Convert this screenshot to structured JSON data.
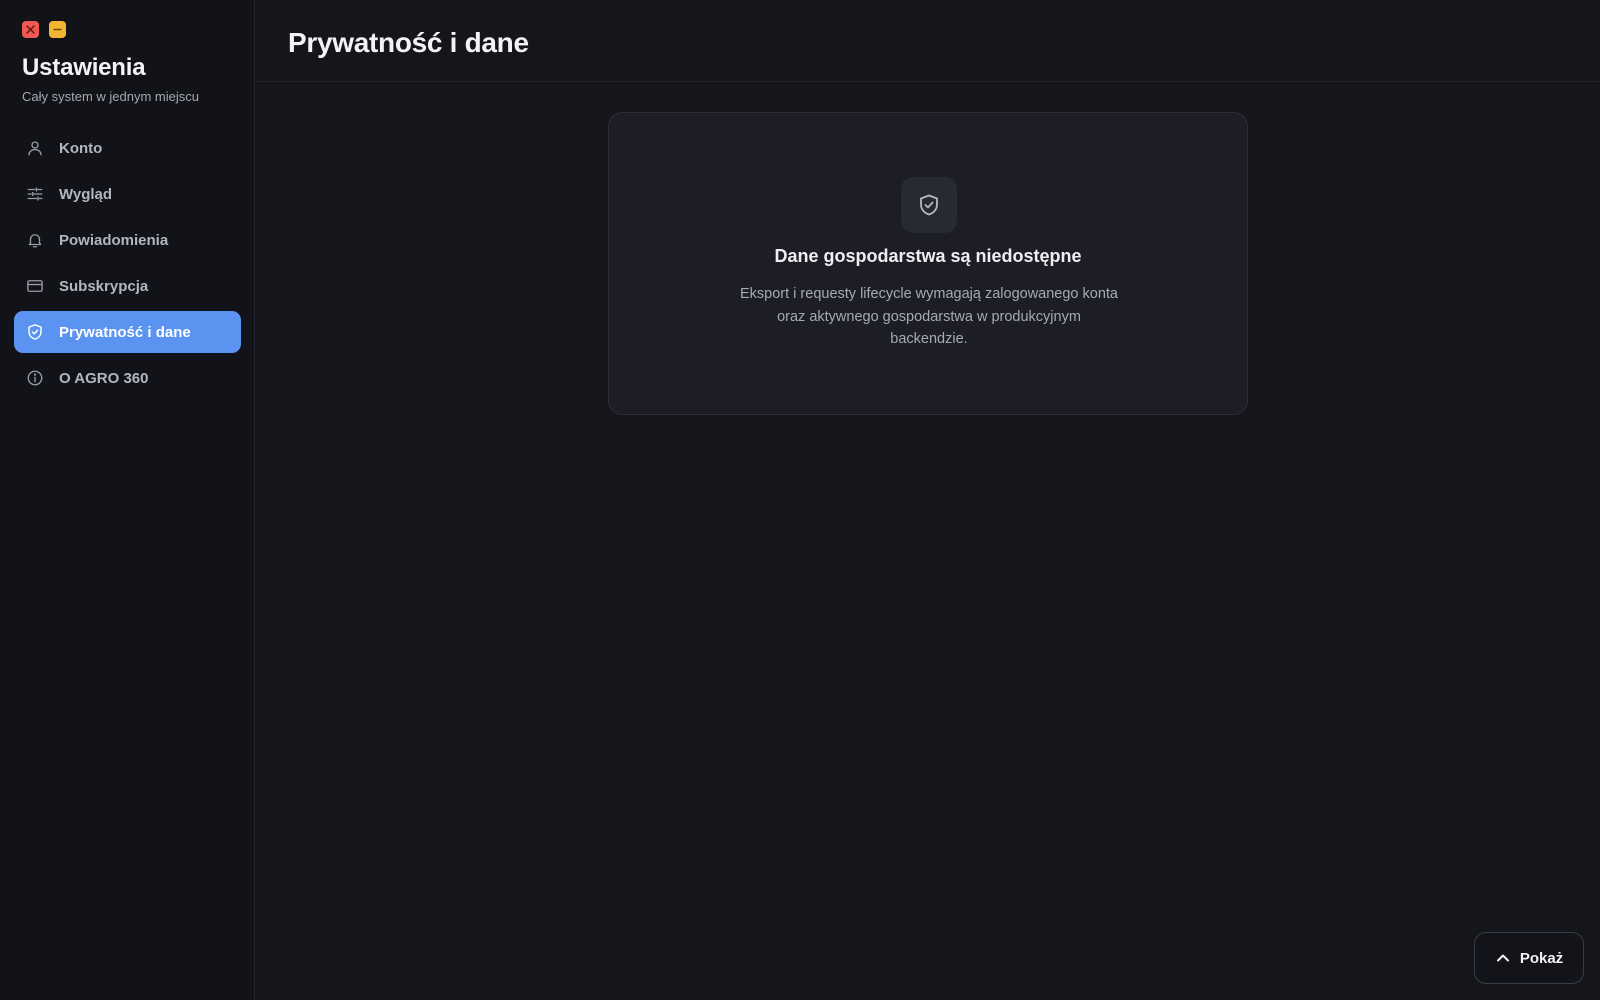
{
  "window": {
    "controls": [
      {
        "name": "close",
        "icon": "close-icon",
        "color": "#ee5a52"
      },
      {
        "name": "minimize",
        "icon": "minimize-icon",
        "color": "#f2b632"
      }
    ]
  },
  "sidebar": {
    "title": "Ustawienia",
    "subtitle": "Cały system w jednym miejscu",
    "items": [
      {
        "label": "Konto",
        "icon": "user-icon",
        "active": false
      },
      {
        "label": "Wygląd",
        "icon": "sliders-icon",
        "active": false
      },
      {
        "label": "Powiadomienia",
        "icon": "bell-icon",
        "active": false
      },
      {
        "label": "Subskrypcja",
        "icon": "credit-card-icon",
        "active": false
      },
      {
        "label": "Prywatność i dane",
        "icon": "shield-check-icon",
        "active": true
      },
      {
        "label": "O AGRO 360",
        "icon": "info-icon",
        "active": false
      }
    ]
  },
  "main": {
    "title": "Prywatność i dane",
    "empty_state": {
      "icon": "shield-check-icon",
      "title": "Dane gospodarstwa są niedostępne",
      "message": "Eksport i requesty lifecycle wymagają zalogowanego konta oraz aktywnego gospodarstwa w produkcyjnym backendzie."
    }
  },
  "footer": {
    "show_button_label": "Pokaż",
    "show_button_icon": "chevron-up-icon"
  },
  "colors": {
    "accent": "#5b93f0",
    "background": "#15161b",
    "sidebar_background": "#121318",
    "card_background": "#1d1e25"
  }
}
